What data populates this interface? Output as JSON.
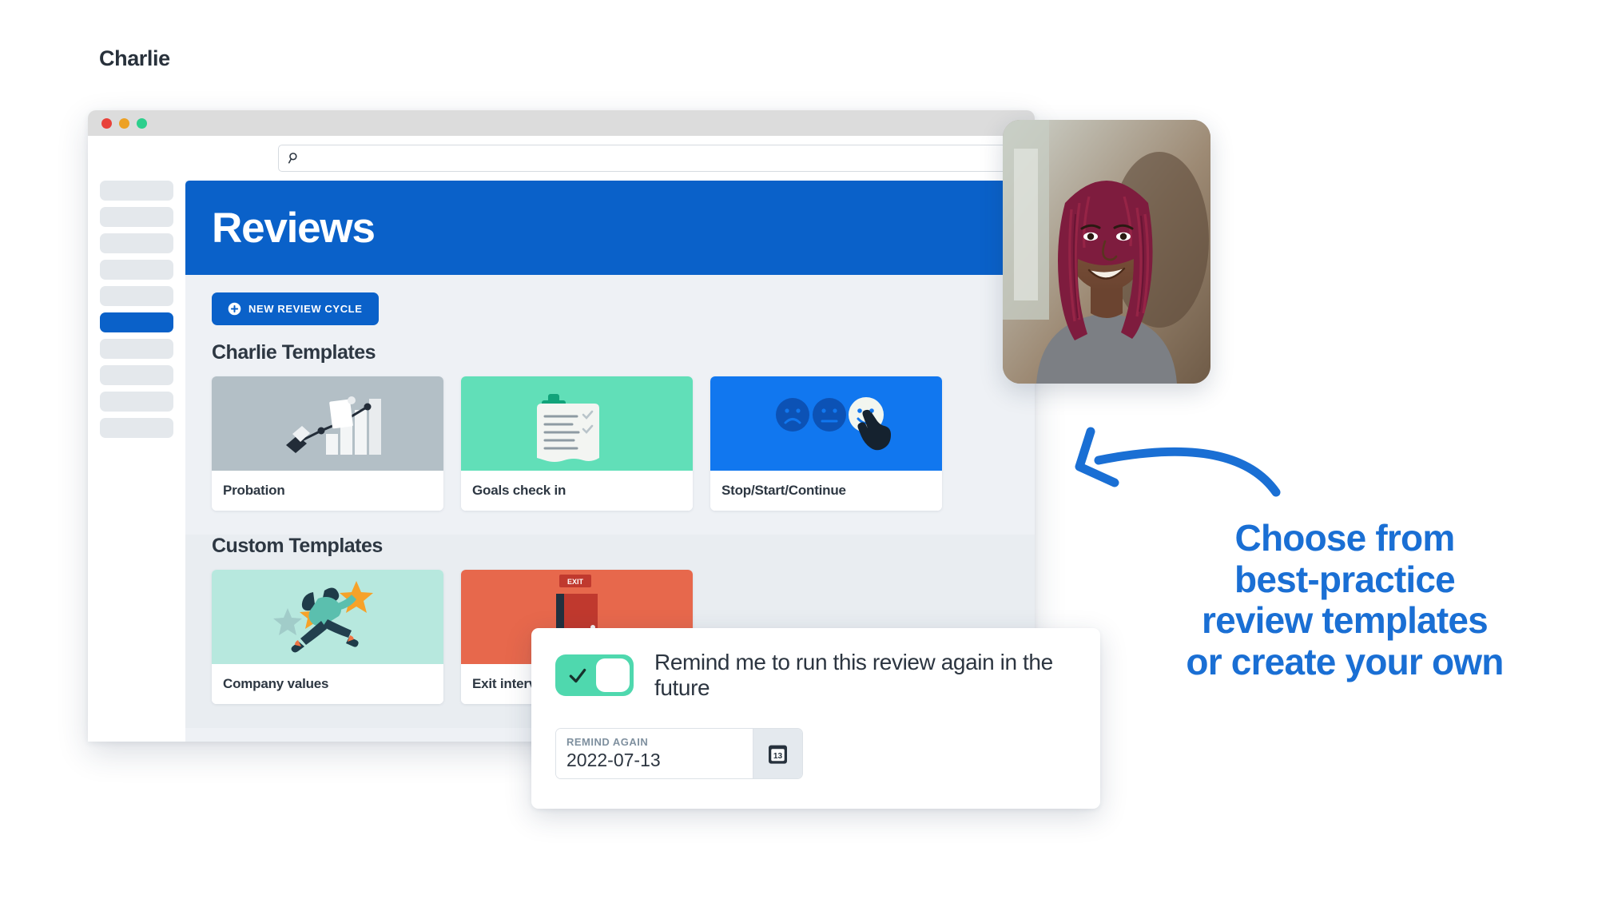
{
  "window": {
    "traffic_lights": [
      "close",
      "minimize",
      "maximize"
    ],
    "brand": "Charlie"
  },
  "search": {
    "icon": "search-icon",
    "value": "",
    "placeholder": ""
  },
  "sidebar": {
    "items": [
      {
        "label": "",
        "active": false
      },
      {
        "label": "",
        "active": false
      },
      {
        "label": "",
        "active": false
      },
      {
        "label": "",
        "active": false
      },
      {
        "label": "",
        "active": false
      },
      {
        "label": "",
        "active": true
      },
      {
        "label": "",
        "active": false
      },
      {
        "label": "",
        "active": false
      },
      {
        "label": "",
        "active": false
      },
      {
        "label": "",
        "active": false
      }
    ]
  },
  "page": {
    "title": "Reviews",
    "header_color": "#0a61c9"
  },
  "toolbar": {
    "new_cycle_label": "NEW REVIEW CYCLE",
    "new_cycle_icon": "plus-circle-icon"
  },
  "sections": [
    {
      "title": "Charlie Templates",
      "cards": [
        {
          "label": "Probation",
          "thumb_color": "#b3bfc6",
          "illustration": "growth-chart-illustration"
        },
        {
          "label": "Goals check in",
          "thumb_color": "#61dfb8",
          "illustration": "clipboard-checklist-illustration"
        },
        {
          "label": "Stop/Start/Continue",
          "thumb_color": "#1177ef",
          "illustration": "emoji-rating-illustration"
        }
      ]
    },
    {
      "title": "Custom Templates",
      "cards": [
        {
          "label": "Company values",
          "thumb_color": "#b7e8de",
          "illustration": "person-reaching-star-illustration"
        },
        {
          "label": "Exit interview",
          "thumb_color": "#e7684c",
          "illustration": "exit-door-illustration"
        }
      ]
    }
  ],
  "remind_popup": {
    "toggle_state": "on",
    "toggle_icon": "check-icon",
    "toggle_color": "#4fd8ae",
    "message": "Remind me to run this review again in the future",
    "date_caption": "REMIND AGAIN",
    "date_value": "2022-07-13",
    "calendar_icon": "calendar-icon",
    "calendar_day": "13"
  },
  "photo": {
    "alt": "smiling-person-portrait"
  },
  "marketing": {
    "arrow_icon": "curved-arrow-left-icon",
    "accent_color": "#1a6fd4",
    "headline_lines": [
      "Choose from",
      "best-practice",
      "review templates",
      "or create your own"
    ]
  }
}
